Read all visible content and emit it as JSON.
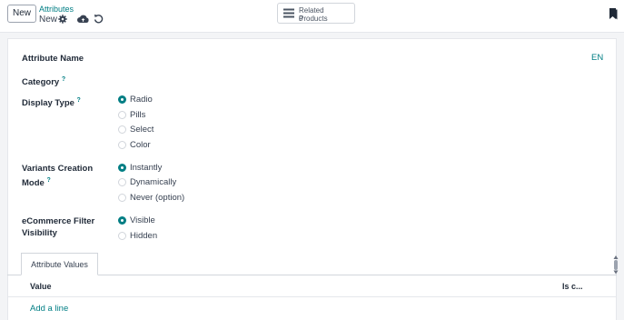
{
  "toolbar": {
    "new_label": "New",
    "breadcrumb_parent": "Attributes",
    "breadcrumb_current": "New",
    "icons": [
      "gear-icon",
      "cloud-upload-icon",
      "undo-icon",
      "bookmark-icon"
    ]
  },
  "smart_button": {
    "label": "Related Products",
    "count": "0"
  },
  "form": {
    "lang": "EN",
    "attribute_name_label": "Attribute Name",
    "category_label": "Category",
    "help_mark": "?",
    "display_type": {
      "label": "Display Type",
      "options": [
        "Radio",
        "Pills",
        "Select",
        "Color"
      ],
      "selected": "Radio"
    },
    "variants_creation": {
      "label_line1": "Variants Creation",
      "label_line2": "Mode",
      "options": [
        "Instantly",
        "Dynamically",
        "Never (option)"
      ],
      "selected": "Instantly"
    },
    "ecommerce_filter": {
      "label_line1": "eCommerce Filter",
      "label_line2": "Visibility",
      "options": [
        "Visible",
        "Hidden"
      ],
      "selected": "Visible"
    }
  },
  "values_tab": {
    "tab_label": "Attribute Values",
    "col_value": "Value",
    "col_is_custom": "Is c...",
    "add_line": "Add a line"
  },
  "colors": {
    "accent": "#017e84"
  }
}
